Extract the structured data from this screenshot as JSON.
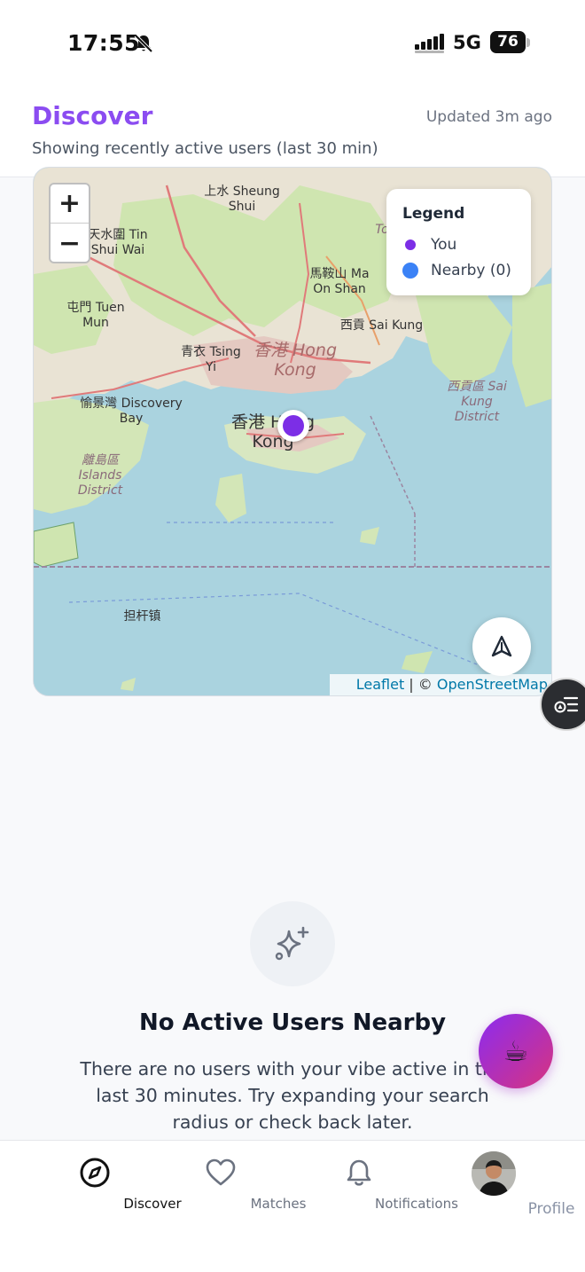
{
  "status_bar": {
    "time": "17:55",
    "network": "5G",
    "battery": "76"
  },
  "header": {
    "title": "Discover",
    "updated": "Updated 3m ago",
    "subtitle": "Showing recently active users (last 30 min)"
  },
  "map": {
    "zoom_in": "+",
    "zoom_out": "−",
    "legend": {
      "title": "Legend",
      "you": "You",
      "nearby": "Nearby (0)"
    },
    "attribution": {
      "leaflet": "Leaflet",
      "separator": " | © ",
      "osm": "OpenStreetMap"
    },
    "labels": {
      "sheung_shui": "上水 Sheung Shui",
      "tin_shui_wai": "天水圍 Tin Shui Wai",
      "tuen_mun": "屯門 Tuen Mun",
      "ma_on_shan": "馬鞍山 Ma On Shan",
      "sai_kung": "西貢 Sai Kung",
      "tsing_yi": "青衣 Tsing Yi",
      "hong_kong_center": "香港 Hong Kong",
      "discovery_bay": "愉景灣 Discovery Bay",
      "hong_kong_island": "香港 Hong Kong",
      "islands_district": "離島區 Islands District",
      "sai_kung_district": "西貢區 Sai Kung District",
      "danganzhen": "担杆镇",
      "tai_po": "To"
    }
  },
  "empty_state": {
    "title": "No Active Users Nearby",
    "description": "There are no users with your vibe active in the last 30 minutes. Try expanding your search radius or check back later."
  },
  "fab": {
    "coffee": "☕"
  },
  "nav": {
    "discover": "Discover",
    "matches": "Matches",
    "notifications": "Notifications",
    "profile": "Profile"
  },
  "colors": {
    "accent": "#8b4cf1",
    "you_dot": "#7c2ee6",
    "nearby_dot": "#3b82f6"
  }
}
